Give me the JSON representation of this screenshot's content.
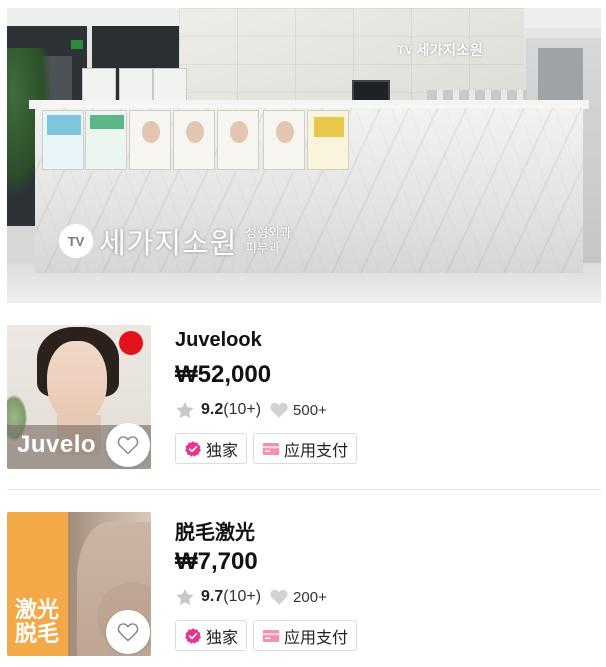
{
  "hero": {
    "wall_brand_tv": "TV",
    "wall_brand": "세가지소원",
    "counter_logo_mark": "TV",
    "counter_logo_name": "세가지소원",
    "counter_logo_sub1": "성형외과",
    "counter_logo_sub2": "피부과"
  },
  "products": [
    {
      "title": "Juvelook",
      "price": "₩52,000",
      "rating": "9.2",
      "reviews": "(10+)",
      "likes": "500+",
      "thumb_text": "Juvelo",
      "tags": [
        {
          "label": "独家",
          "icon": "verified-badge-icon",
          "color": "#e8338a"
        },
        {
          "label": "应用支付",
          "icon": "card-payment-icon",
          "color": "#f28fb3"
        }
      ]
    },
    {
      "title": "脱毛激光",
      "price": "₩7,700",
      "rating": "9.7",
      "reviews": "(10+)",
      "likes": "200+",
      "thumb_text": "激光脱毛",
      "tags": [
        {
          "label": "独家",
          "icon": "verified-badge-icon",
          "color": "#e8338a"
        },
        {
          "label": "应用支付",
          "icon": "card-payment-icon",
          "color": "#f28fb3"
        }
      ]
    }
  ],
  "colors": {
    "star": "#c8c8c8",
    "heart": "#d2d2d2",
    "accent_pink": "#e8338a",
    "thumb_orange": "#f4a949"
  }
}
